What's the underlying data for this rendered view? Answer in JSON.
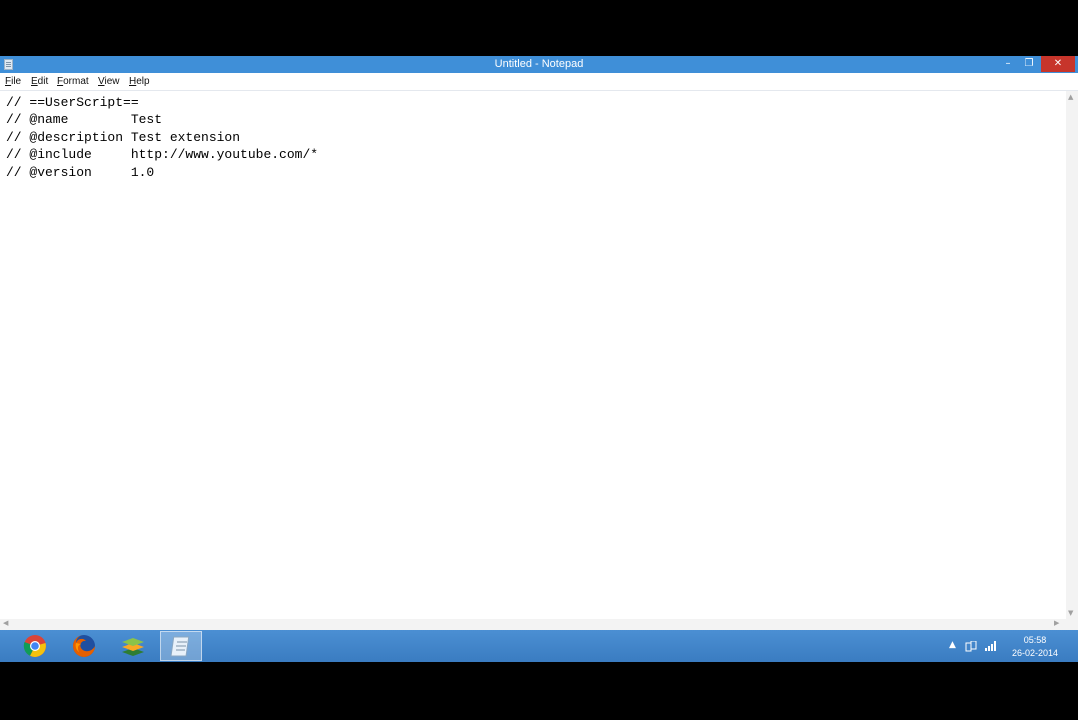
{
  "window": {
    "title": "Untitled - Notepad",
    "controls": {
      "minimize": "–",
      "maximize": "❐",
      "close": "✕"
    }
  },
  "menu": [
    "File",
    "Edit",
    "Format",
    "View",
    "Help"
  ],
  "editor": {
    "content": "// ==UserScript==\n// @name        Test\n// @description Test extension\n// @include     http://www.youtube.com/*\n// @version     1.0"
  },
  "taskbar": {
    "apps": [
      {
        "icon": "chrome-icon",
        "active": false
      },
      {
        "icon": "firefox-icon",
        "active": false
      },
      {
        "icon": "bluestacks-icon",
        "active": false
      },
      {
        "icon": "notepad-icon",
        "active": true
      }
    ],
    "tray_icons": [
      "show-hidden-icons-icon",
      "network-icon",
      "signal-icon"
    ],
    "clock": {
      "time": "05:58",
      "date": "26-02-2014"
    }
  },
  "colors": {
    "titlebar": "#3f8fd8",
    "taskbar": "#3f84c9",
    "close_button": "#c7352b"
  }
}
